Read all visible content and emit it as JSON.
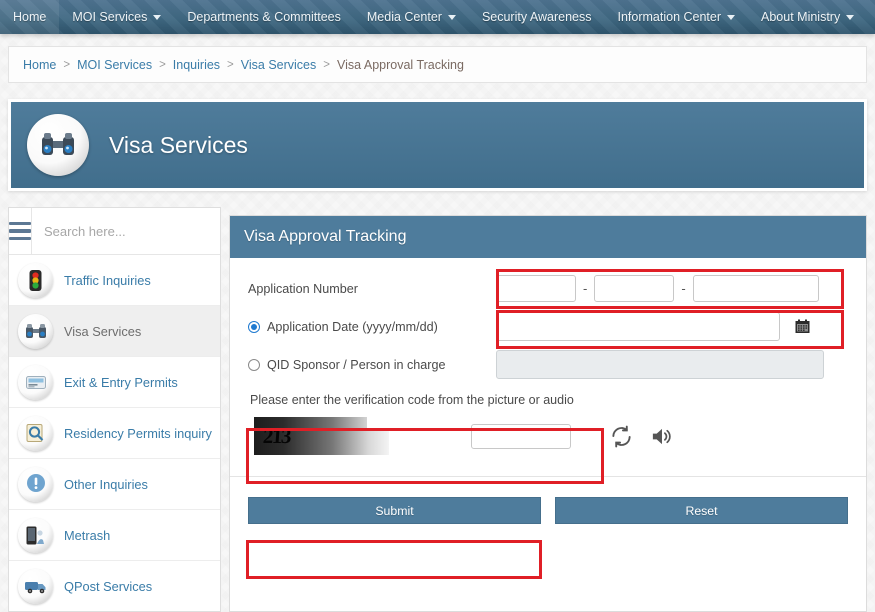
{
  "topnav": {
    "items": [
      {
        "label": "Home",
        "caret": false
      },
      {
        "label": "MOI Services",
        "caret": true
      },
      {
        "label": "Departments & Committees",
        "caret": false
      },
      {
        "label": "Media Center",
        "caret": true
      },
      {
        "label": "Security Awareness",
        "caret": false
      },
      {
        "label": "Information Center",
        "caret": true
      },
      {
        "label": "About Ministry",
        "caret": true
      }
    ]
  },
  "breadcrumb": {
    "separator": ">",
    "items": [
      {
        "label": "Home",
        "current": false
      },
      {
        "label": "MOI Services",
        "current": false
      },
      {
        "label": "Inquiries",
        "current": false
      },
      {
        "label": "Visa Services",
        "current": false
      },
      {
        "label": "Visa Approval Tracking",
        "current": true
      }
    ]
  },
  "banner": {
    "title": "Visa Services",
    "icon": "binoculars-icon"
  },
  "sidebar": {
    "menu_icon": "hamburger-menu-icon",
    "search": {
      "placeholder": "Search here...",
      "value": ""
    },
    "items": [
      {
        "label": "Traffic Inquiries",
        "icon": "traffic-light-icon",
        "active": false
      },
      {
        "label": "Visa Services",
        "icon": "binoculars-icon",
        "active": true
      },
      {
        "label": "Exit & Entry Permits",
        "icon": "passport-icon",
        "active": false
      },
      {
        "label": "Residency Permits inquiry",
        "icon": "magnifier-document-icon",
        "active": false
      },
      {
        "label": "Other Inquiries",
        "icon": "exclamation-icon",
        "active": false
      },
      {
        "label": "Metrash",
        "icon": "mobile-device-icon",
        "active": false
      },
      {
        "label": "QPost Services",
        "icon": "delivery-truck-icon",
        "active": false
      }
    ]
  },
  "panel": {
    "title": "Visa Approval Tracking",
    "application_number": {
      "label": "Application Number",
      "separator": "-",
      "parts": [
        {
          "value": "",
          "placeholder": ""
        },
        {
          "value": "",
          "placeholder": ""
        },
        {
          "value": "",
          "placeholder": ""
        }
      ]
    },
    "application_date": {
      "label": "Application Date  (yyyy/mm/dd)",
      "selected": true,
      "value": "",
      "placeholder": "",
      "calendar_icon": "calendar-icon"
    },
    "qid_sponsor": {
      "label": "QID Sponsor / Person in charge",
      "selected": false,
      "value": "",
      "placeholder": "",
      "disabled": true
    },
    "captcha": {
      "note": "Please enter the verification code from the picture or audio",
      "code": "213",
      "input_value": "",
      "input_placeholder": "",
      "refresh_icon": "refresh-icon",
      "audio_icon": "speaker-icon"
    },
    "buttons": {
      "submit": "Submit",
      "reset": "Reset"
    }
  },
  "colors": {
    "nav_blue": "#406983",
    "panel_blue": "#4e7c9c",
    "link_blue": "#3a7ca8",
    "highlight_red": "#e01f26",
    "page_bg": "#f7f7f7"
  },
  "annotations": [
    {
      "name": "application-number-highlight",
      "target": "application-number-inputs"
    },
    {
      "name": "application-date-highlight",
      "target": "application-date-input"
    },
    {
      "name": "captcha-highlight",
      "target": "captcha-row"
    },
    {
      "name": "submit-highlight",
      "target": "submit-button"
    }
  ]
}
